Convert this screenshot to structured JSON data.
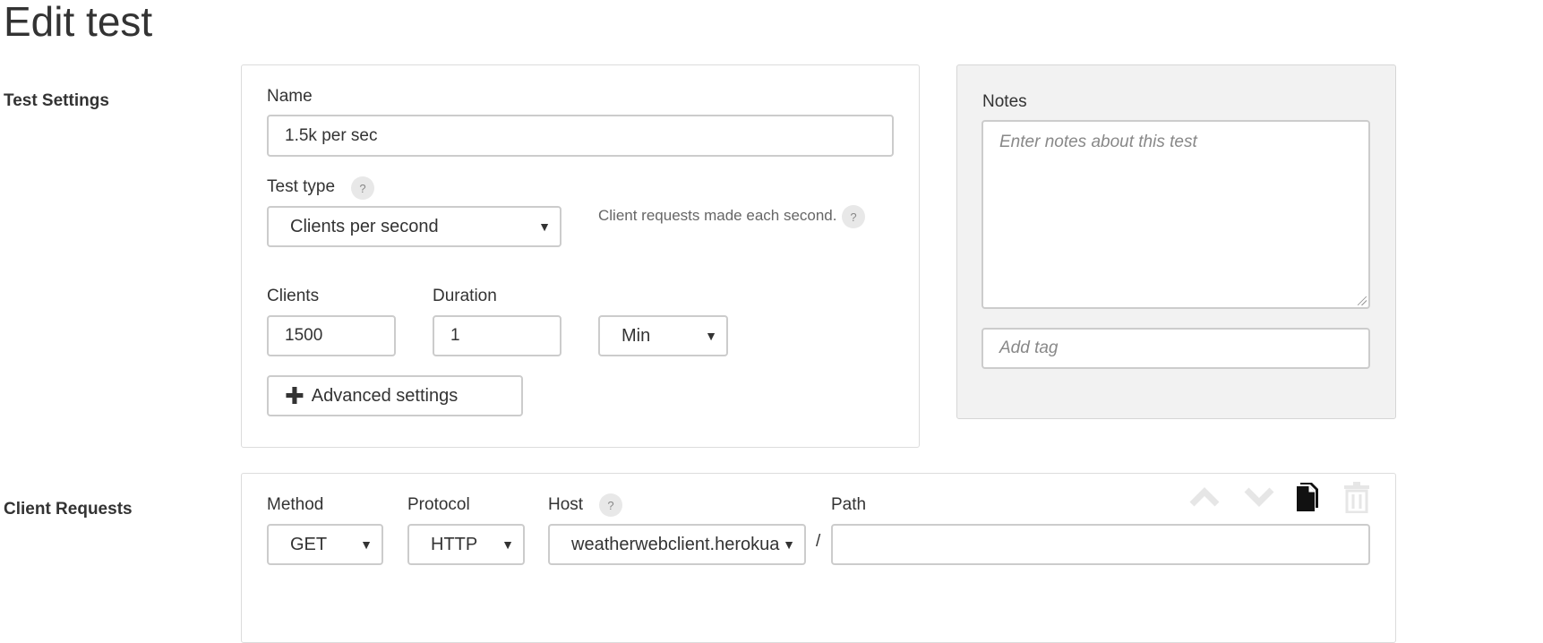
{
  "page": {
    "title": "Edit test"
  },
  "sections": {
    "test_settings": "Test Settings",
    "client_requests": "Client Requests"
  },
  "test_settings": {
    "name_label": "Name",
    "name_value": "1.5k per sec",
    "test_type_label": "Test type",
    "test_type_help": "?",
    "test_type_value": "Clients per second",
    "test_type_hint": "Client requests made each second.",
    "test_type_hint_help": "?",
    "clients_label": "Clients",
    "clients_value": "1500",
    "duration_label": "Duration",
    "duration_value": "1",
    "duration_unit": "Min",
    "advanced_button": "Advanced settings"
  },
  "notes": {
    "label": "Notes",
    "placeholder": "Enter notes about this test",
    "tag_placeholder": "Add tag"
  },
  "client_requests": {
    "method_label": "Method",
    "method_value": "GET",
    "protocol_label": "Protocol",
    "protocol_value": "HTTP",
    "host_label": "Host",
    "host_help": "?",
    "host_value": "weatherwebclient.herokua",
    "separator": "/",
    "path_label": "Path",
    "path_value": ""
  },
  "icons": {
    "move_up": "chevron-up-icon",
    "move_down": "chevron-down-icon",
    "copy": "copy-icon",
    "delete": "trash-icon"
  },
  "colors": {
    "border": "#cccccc",
    "panel_gray": "#f2f2f2",
    "text": "#333333",
    "muted": "#888888",
    "disabled_icon": "#e6e6e6"
  }
}
